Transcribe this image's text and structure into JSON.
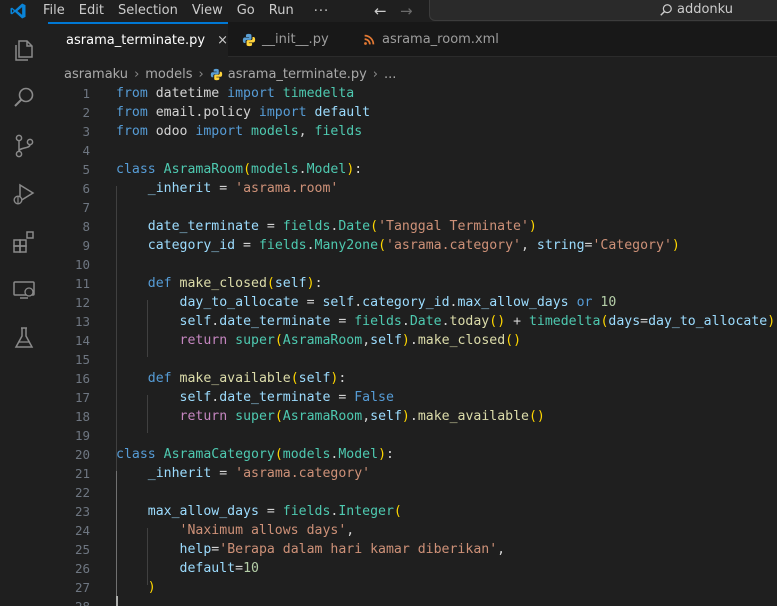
{
  "menu": [
    "File",
    "Edit",
    "Selection",
    "View",
    "Go",
    "Run"
  ],
  "menu_more": "···",
  "command_center": {
    "label": "addonku"
  },
  "tabs": [
    {
      "label": "asrama_terminate.py",
      "active": true,
      "icon": "python-icon"
    },
    {
      "label": "__init__.py",
      "active": false,
      "icon": "python-icon"
    },
    {
      "label": "asrama_room.xml",
      "active": false,
      "icon": "xml-icon"
    }
  ],
  "tab_close": "×",
  "breadcrumb": {
    "folder1": "asramaku",
    "folder2": "models",
    "file": "asrama_terminate.py",
    "more": "..."
  },
  "activity_icons": [
    "explorer-icon",
    "search-icon",
    "source-control-icon",
    "run-debug-icon",
    "extensions-icon",
    "remote-explorer-icon",
    "testing-icon"
  ],
  "code_lines": [
    [
      [
        "kw",
        "from"
      ],
      [
        "p",
        " datetime "
      ],
      [
        "kw",
        "import"
      ],
      [
        "p",
        " "
      ],
      [
        "cls",
        "timedelta"
      ]
    ],
    [
      [
        "kw",
        "from"
      ],
      [
        "p",
        " email.policy "
      ],
      [
        "kw",
        "import"
      ],
      [
        "p",
        " "
      ],
      [
        "var",
        "default"
      ]
    ],
    [
      [
        "kw",
        "from"
      ],
      [
        "p",
        " odoo "
      ],
      [
        "kw",
        "import"
      ],
      [
        "p",
        " "
      ],
      [
        "cls",
        "models"
      ],
      [
        "p",
        ", "
      ],
      [
        "cls",
        "fields"
      ]
    ],
    [],
    [
      [
        "kw",
        "class"
      ],
      [
        "p",
        " "
      ],
      [
        "cls",
        "AsramaRoom"
      ],
      [
        "br1",
        "("
      ],
      [
        "cls",
        "models"
      ],
      [
        "p",
        "."
      ],
      [
        "cls",
        "Model"
      ],
      [
        "br1",
        ")"
      ],
      [
        "p",
        ":"
      ]
    ],
    [
      [
        "p",
        "    "
      ],
      [
        "var",
        "_inherit"
      ],
      [
        "p",
        " = "
      ],
      [
        "str",
        "'asrama.room'"
      ]
    ],
    [],
    [
      [
        "p",
        "    "
      ],
      [
        "var",
        "date_terminate"
      ],
      [
        "p",
        " = "
      ],
      [
        "cls",
        "fields"
      ],
      [
        "p",
        "."
      ],
      [
        "cls",
        "Date"
      ],
      [
        "br1",
        "("
      ],
      [
        "str",
        "'Tanggal Terminate'"
      ],
      [
        "br1",
        ")"
      ]
    ],
    [
      [
        "p",
        "    "
      ],
      [
        "var",
        "category_id"
      ],
      [
        "p",
        " = "
      ],
      [
        "cls",
        "fields"
      ],
      [
        "p",
        "."
      ],
      [
        "cls",
        "Many2one"
      ],
      [
        "br1",
        "("
      ],
      [
        "str",
        "'asrama.category'"
      ],
      [
        "p",
        ", "
      ],
      [
        "var",
        "string"
      ],
      [
        "p",
        "="
      ],
      [
        "str",
        "'Category'"
      ],
      [
        "br1",
        ")"
      ]
    ],
    [],
    [
      [
        "p",
        "    "
      ],
      [
        "kw",
        "def"
      ],
      [
        "p",
        " "
      ],
      [
        "fn",
        "make_closed"
      ],
      [
        "br1",
        "("
      ],
      [
        "var",
        "self"
      ],
      [
        "br1",
        ")"
      ],
      [
        "p",
        ":"
      ]
    ],
    [
      [
        "p",
        "        "
      ],
      [
        "var",
        "day_to_allocate"
      ],
      [
        "p",
        " = "
      ],
      [
        "var",
        "self"
      ],
      [
        "p",
        "."
      ],
      [
        "var",
        "category_id"
      ],
      [
        "p",
        "."
      ],
      [
        "var",
        "max_allow_days"
      ],
      [
        "p",
        " "
      ],
      [
        "kw",
        "or"
      ],
      [
        "p",
        " "
      ],
      [
        "num",
        "10"
      ]
    ],
    [
      [
        "p",
        "        "
      ],
      [
        "var",
        "self"
      ],
      [
        "p",
        "."
      ],
      [
        "var",
        "date_terminate"
      ],
      [
        "p",
        " = "
      ],
      [
        "cls",
        "fields"
      ],
      [
        "p",
        "."
      ],
      [
        "cls",
        "Date"
      ],
      [
        "p",
        "."
      ],
      [
        "fn",
        "today"
      ],
      [
        "br1",
        "()"
      ],
      [
        "p",
        " + "
      ],
      [
        "cls",
        "timedelta"
      ],
      [
        "br1",
        "("
      ],
      [
        "var",
        "days"
      ],
      [
        "p",
        "="
      ],
      [
        "var",
        "day_to_allocate"
      ],
      [
        "br1",
        ")"
      ]
    ],
    [
      [
        "p",
        "        "
      ],
      [
        "ctl",
        "return"
      ],
      [
        "p",
        " "
      ],
      [
        "cls",
        "super"
      ],
      [
        "br1",
        "("
      ],
      [
        "cls",
        "AsramaRoom"
      ],
      [
        "p",
        ","
      ],
      [
        "var",
        "self"
      ],
      [
        "br1",
        ")"
      ],
      [
        "p",
        "."
      ],
      [
        "fn",
        "make_closed"
      ],
      [
        "br1",
        "()"
      ]
    ],
    [],
    [
      [
        "p",
        "    "
      ],
      [
        "kw",
        "def"
      ],
      [
        "p",
        " "
      ],
      [
        "fn",
        "make_available"
      ],
      [
        "br1",
        "("
      ],
      [
        "var",
        "self"
      ],
      [
        "br1",
        ")"
      ],
      [
        "p",
        ":"
      ]
    ],
    [
      [
        "p",
        "        "
      ],
      [
        "var",
        "self"
      ],
      [
        "p",
        "."
      ],
      [
        "var",
        "date_terminate"
      ],
      [
        "p",
        " = "
      ],
      [
        "kw",
        "False"
      ]
    ],
    [
      [
        "p",
        "        "
      ],
      [
        "ctl",
        "return"
      ],
      [
        "p",
        " "
      ],
      [
        "cls",
        "super"
      ],
      [
        "br1",
        "("
      ],
      [
        "cls",
        "AsramaRoom"
      ],
      [
        "p",
        ","
      ],
      [
        "var",
        "self"
      ],
      [
        "br1",
        ")"
      ],
      [
        "p",
        "."
      ],
      [
        "fn",
        "make_available"
      ],
      [
        "br1",
        "()"
      ]
    ],
    [],
    [
      [
        "kw",
        "class"
      ],
      [
        "p",
        " "
      ],
      [
        "cls",
        "AsramaCategory"
      ],
      [
        "br1",
        "("
      ],
      [
        "cls",
        "models"
      ],
      [
        "p",
        "."
      ],
      [
        "cls",
        "Model"
      ],
      [
        "br1",
        ")"
      ],
      [
        "p",
        ":"
      ]
    ],
    [
      [
        "p",
        "    "
      ],
      [
        "var",
        "_inherit"
      ],
      [
        "p",
        " = "
      ],
      [
        "str",
        "'asrama.category'"
      ]
    ],
    [],
    [
      [
        "p",
        "    "
      ],
      [
        "var",
        "max_allow_days"
      ],
      [
        "p",
        " = "
      ],
      [
        "cls",
        "fields"
      ],
      [
        "p",
        "."
      ],
      [
        "cls",
        "Integer"
      ],
      [
        "br1",
        "("
      ]
    ],
    [
      [
        "p",
        "        "
      ],
      [
        "str",
        "'Naximum allows days'"
      ],
      [
        "p",
        ","
      ]
    ],
    [
      [
        "p",
        "        "
      ],
      [
        "var",
        "help"
      ],
      [
        "p",
        "="
      ],
      [
        "str",
        "'Berapa dalam hari kamar diberikan'"
      ],
      [
        "p",
        ","
      ]
    ],
    [
      [
        "p",
        "        "
      ],
      [
        "var",
        "default"
      ],
      [
        "p",
        "="
      ],
      [
        "num",
        "10"
      ]
    ],
    [
      [
        "p",
        "    "
      ],
      [
        "br1",
        ")"
      ]
    ],
    []
  ],
  "colors": {
    "keyword": "#569cd6",
    "control": "#c586c0",
    "class": "#4ec9b0",
    "function": "#dcdcaa",
    "variable": "#9cdcfe",
    "string": "#ce9178",
    "number": "#b5cea8",
    "bracket": "#ffd700",
    "accent": "#0078d4",
    "background": "#1f1f1f"
  }
}
